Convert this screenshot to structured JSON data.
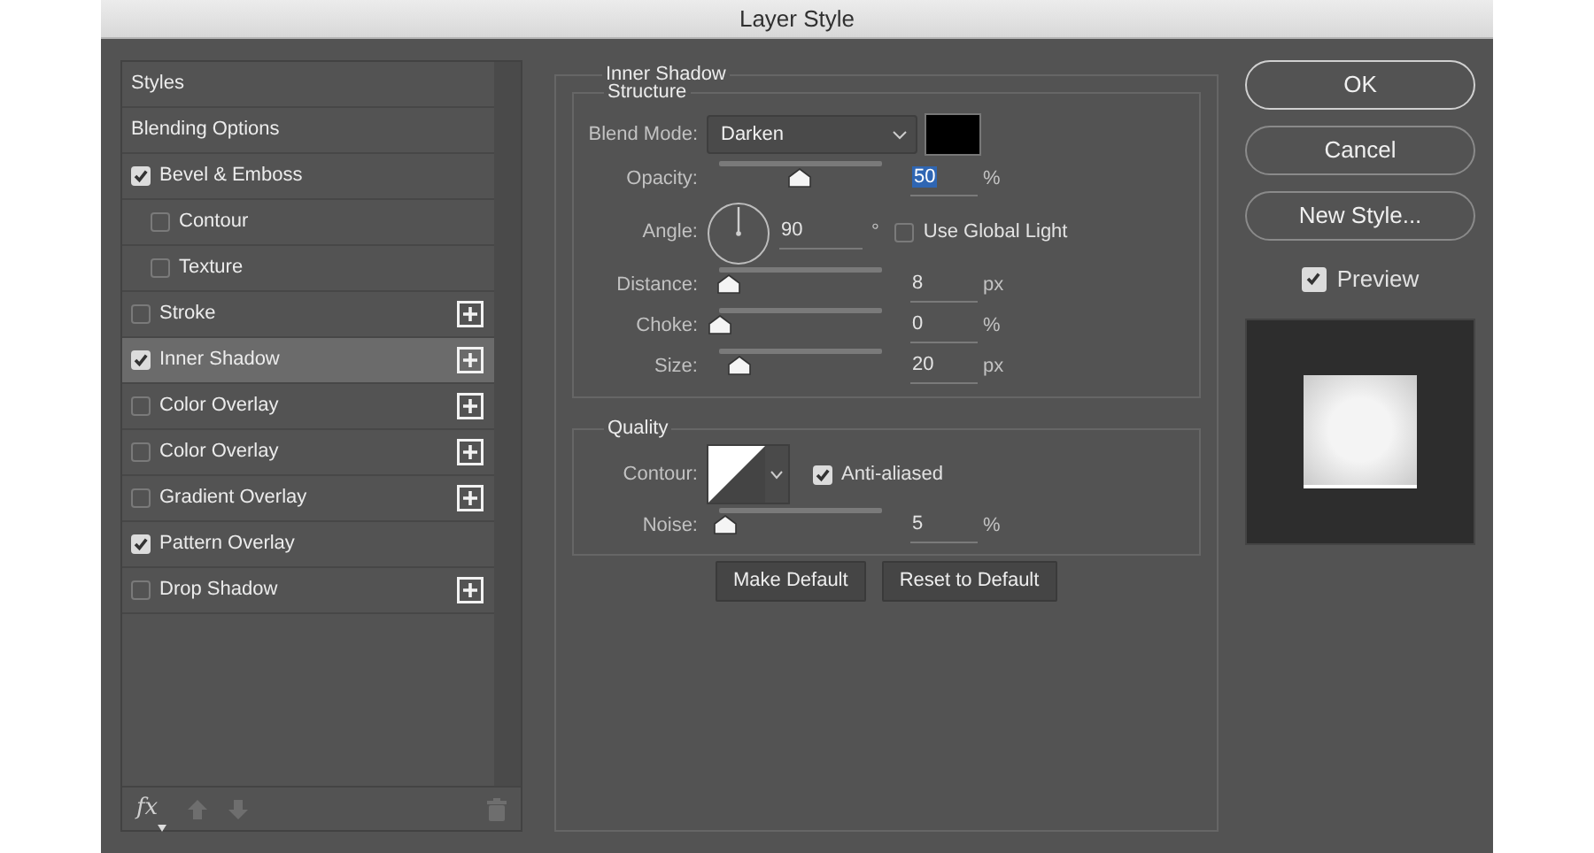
{
  "window": {
    "title": "Layer Style"
  },
  "styles_list": {
    "items": [
      {
        "kind": "header",
        "label": "Styles",
        "selected": false
      },
      {
        "kind": "header",
        "label": "Blending Options",
        "selected": false
      },
      {
        "kind": "effect",
        "label": "Bevel & Emboss",
        "checked": true,
        "selected": false,
        "addable": false,
        "children": [
          {
            "kind": "effect",
            "label": "Contour",
            "checked": false,
            "selected": false,
            "addable": false
          },
          {
            "kind": "effect",
            "label": "Texture",
            "checked": false,
            "selected": false,
            "addable": false
          }
        ]
      },
      {
        "kind": "effect",
        "label": "Stroke",
        "checked": false,
        "selected": false,
        "addable": true
      },
      {
        "kind": "effect",
        "label": "Inner Shadow",
        "checked": true,
        "selected": true,
        "addable": true
      },
      {
        "kind": "effect",
        "label": "Color Overlay",
        "checked": false,
        "selected": false,
        "addable": true
      },
      {
        "kind": "effect",
        "label": "Color Overlay",
        "checked": false,
        "selected": false,
        "addable": true
      },
      {
        "kind": "effect",
        "label": "Gradient Overlay",
        "checked": false,
        "selected": false,
        "addable": true
      },
      {
        "kind": "effect",
        "label": "Pattern Overlay",
        "checked": true,
        "selected": false,
        "addable": false
      },
      {
        "kind": "effect",
        "label": "Drop Shadow",
        "checked": false,
        "selected": false,
        "addable": true
      }
    ],
    "toolbar": {
      "fx_label": "fx"
    }
  },
  "inner_shadow": {
    "title": "Inner Shadow",
    "structure": {
      "title": "Structure",
      "blend_mode": {
        "label": "Blend Mode:",
        "value": "Darken",
        "color": "#000000"
      },
      "rows": [
        {
          "kind": "slider",
          "label": "Opacity:",
          "level": 0.49,
          "value": "50",
          "unit": "%",
          "highlighted": true
        },
        {
          "kind": "angle",
          "label": "Angle:",
          "value": "90",
          "unit": "°",
          "global_light": {
            "label": "Use Global Light",
            "checked": false
          }
        },
        {
          "kind": "slider",
          "label": "Distance:",
          "level": 0.05,
          "value": "8",
          "unit": "px",
          "highlighted": false
        },
        {
          "kind": "slider",
          "label": "Choke:",
          "level": 0,
          "value": "0",
          "unit": "%",
          "highlighted": false
        },
        {
          "kind": "slider",
          "label": "Size:",
          "level": 0.12,
          "value": "20",
          "unit": "px",
          "highlighted": false
        }
      ]
    },
    "quality": {
      "title": "Quality",
      "contour": {
        "label": "Contour:",
        "anti_aliased": {
          "label": "Anti-aliased",
          "checked": true
        }
      },
      "rows": [
        {
          "kind": "slider",
          "label": "Noise:",
          "level": 0.03,
          "value": "5",
          "unit": "%",
          "highlighted": false
        }
      ]
    },
    "buttons": [
      "Make Default",
      "Reset to Default"
    ]
  },
  "actions": {
    "buttons": [
      {
        "label": "OK",
        "default": true
      },
      {
        "label": "Cancel",
        "default": false
      },
      {
        "label": "New Style...",
        "default": false
      }
    ],
    "preview": {
      "label": "Preview",
      "checked": true
    }
  }
}
